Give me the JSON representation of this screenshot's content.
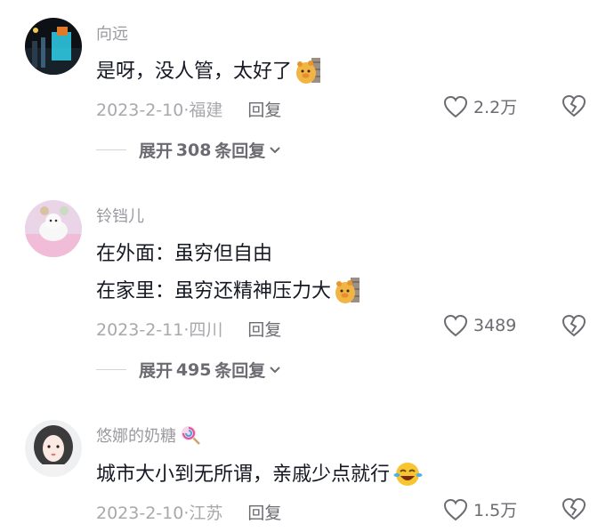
{
  "comments": [
    {
      "username": "向远",
      "lines": [
        "是呀，没人管，太好了"
      ],
      "emoji": "pig-emoji",
      "date": "2023-2-10",
      "location": "福建",
      "reply_label": "回复",
      "likes": "2.2万",
      "expand": {
        "pre": "展开",
        "count": "308",
        "post": "条回复"
      }
    },
    {
      "username": "铃铛儿",
      "lines": [
        "在外面：虽穷但自由",
        "在家里：虽穷还精神压力大"
      ],
      "emoji": "pig-emoji",
      "date": "2023-2-11",
      "location": "四川",
      "reply_label": "回复",
      "likes": "3489",
      "expand": {
        "pre": "展开",
        "count": "495",
        "post": "条回复"
      }
    },
    {
      "username": "悠娜的奶糖",
      "username_emoji": "lollipop-emoji",
      "lines": [
        "城市大小到无所谓，亲戚少点就行"
      ],
      "emoji": "laughing-crying-emoji",
      "date": "2023-2-10",
      "location": "江苏",
      "reply_label": "回复",
      "likes": "1.5万"
    }
  ],
  "colors": {
    "text": "#161823",
    "muted": "#a8a8ad",
    "secondary": "#6b6b72"
  }
}
